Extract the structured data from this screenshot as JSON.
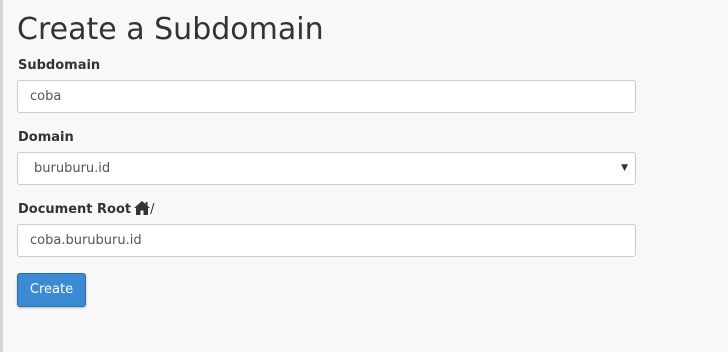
{
  "page": {
    "title": "Create a Subdomain"
  },
  "form": {
    "subdomain": {
      "label": "Subdomain",
      "value": "coba"
    },
    "domain": {
      "label": "Domain",
      "selected": "buruburu.id"
    },
    "document_root": {
      "label": "Document Root",
      "icon": "home-icon",
      "prefix": "/",
      "value": "coba.buruburu.id"
    },
    "submit_label": "Create"
  },
  "colors": {
    "background": "#f8f8f8",
    "button_primary": "#3b8bd4",
    "input_border": "#cccccc"
  }
}
